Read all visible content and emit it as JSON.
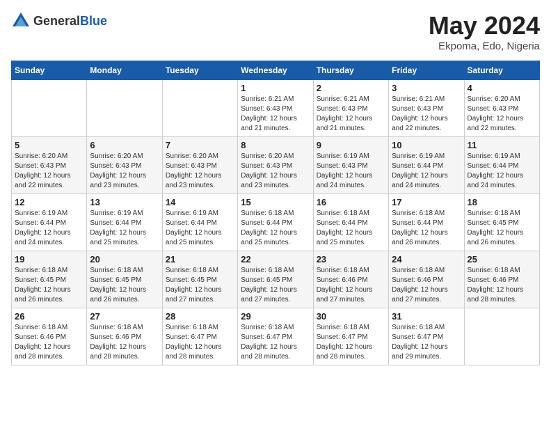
{
  "header": {
    "logo_general": "General",
    "logo_blue": "Blue",
    "title": "May 2024",
    "location": "Ekpoma, Edo, Nigeria"
  },
  "days_of_week": [
    "Sunday",
    "Monday",
    "Tuesday",
    "Wednesday",
    "Thursday",
    "Friday",
    "Saturday"
  ],
  "weeks": [
    [
      {
        "day": "",
        "sunrise": "",
        "sunset": "",
        "daylight": ""
      },
      {
        "day": "",
        "sunrise": "",
        "sunset": "",
        "daylight": ""
      },
      {
        "day": "",
        "sunrise": "",
        "sunset": "",
        "daylight": ""
      },
      {
        "day": "1",
        "sunrise": "Sunrise: 6:21 AM",
        "sunset": "Sunset: 6:43 PM",
        "daylight": "Daylight: 12 hours and 21 minutes."
      },
      {
        "day": "2",
        "sunrise": "Sunrise: 6:21 AM",
        "sunset": "Sunset: 6:43 PM",
        "daylight": "Daylight: 12 hours and 21 minutes."
      },
      {
        "day": "3",
        "sunrise": "Sunrise: 6:21 AM",
        "sunset": "Sunset: 6:43 PM",
        "daylight": "Daylight: 12 hours and 22 minutes."
      },
      {
        "day": "4",
        "sunrise": "Sunrise: 6:20 AM",
        "sunset": "Sunset: 6:43 PM",
        "daylight": "Daylight: 12 hours and 22 minutes."
      }
    ],
    [
      {
        "day": "5",
        "sunrise": "Sunrise: 6:20 AM",
        "sunset": "Sunset: 6:43 PM",
        "daylight": "Daylight: 12 hours and 22 minutes."
      },
      {
        "day": "6",
        "sunrise": "Sunrise: 6:20 AM",
        "sunset": "Sunset: 6:43 PM",
        "daylight": "Daylight: 12 hours and 23 minutes."
      },
      {
        "day": "7",
        "sunrise": "Sunrise: 6:20 AM",
        "sunset": "Sunset: 6:43 PM",
        "daylight": "Daylight: 12 hours and 23 minutes."
      },
      {
        "day": "8",
        "sunrise": "Sunrise: 6:20 AM",
        "sunset": "Sunset: 6:43 PM",
        "daylight": "Daylight: 12 hours and 23 minutes."
      },
      {
        "day": "9",
        "sunrise": "Sunrise: 6:19 AM",
        "sunset": "Sunset: 6:43 PM",
        "daylight": "Daylight: 12 hours and 24 minutes."
      },
      {
        "day": "10",
        "sunrise": "Sunrise: 6:19 AM",
        "sunset": "Sunset: 6:44 PM",
        "daylight": "Daylight: 12 hours and 24 minutes."
      },
      {
        "day": "11",
        "sunrise": "Sunrise: 6:19 AM",
        "sunset": "Sunset: 6:44 PM",
        "daylight": "Daylight: 12 hours and 24 minutes."
      }
    ],
    [
      {
        "day": "12",
        "sunrise": "Sunrise: 6:19 AM",
        "sunset": "Sunset: 6:44 PM",
        "daylight": "Daylight: 12 hours and 24 minutes."
      },
      {
        "day": "13",
        "sunrise": "Sunrise: 6:19 AM",
        "sunset": "Sunset: 6:44 PM",
        "daylight": "Daylight: 12 hours and 25 minutes."
      },
      {
        "day": "14",
        "sunrise": "Sunrise: 6:19 AM",
        "sunset": "Sunset: 6:44 PM",
        "daylight": "Daylight: 12 hours and 25 minutes."
      },
      {
        "day": "15",
        "sunrise": "Sunrise: 6:18 AM",
        "sunset": "Sunset: 6:44 PM",
        "daylight": "Daylight: 12 hours and 25 minutes."
      },
      {
        "day": "16",
        "sunrise": "Sunrise: 6:18 AM",
        "sunset": "Sunset: 6:44 PM",
        "daylight": "Daylight: 12 hours and 25 minutes."
      },
      {
        "day": "17",
        "sunrise": "Sunrise: 6:18 AM",
        "sunset": "Sunset: 6:44 PM",
        "daylight": "Daylight: 12 hours and 26 minutes."
      },
      {
        "day": "18",
        "sunrise": "Sunrise: 6:18 AM",
        "sunset": "Sunset: 6:45 PM",
        "daylight": "Daylight: 12 hours and 26 minutes."
      }
    ],
    [
      {
        "day": "19",
        "sunrise": "Sunrise: 6:18 AM",
        "sunset": "Sunset: 6:45 PM",
        "daylight": "Daylight: 12 hours and 26 minutes."
      },
      {
        "day": "20",
        "sunrise": "Sunrise: 6:18 AM",
        "sunset": "Sunset: 6:45 PM",
        "daylight": "Daylight: 12 hours and 26 minutes."
      },
      {
        "day": "21",
        "sunrise": "Sunrise: 6:18 AM",
        "sunset": "Sunset: 6:45 PM",
        "daylight": "Daylight: 12 hours and 27 minutes."
      },
      {
        "day": "22",
        "sunrise": "Sunrise: 6:18 AM",
        "sunset": "Sunset: 6:45 PM",
        "daylight": "Daylight: 12 hours and 27 minutes."
      },
      {
        "day": "23",
        "sunrise": "Sunrise: 6:18 AM",
        "sunset": "Sunset: 6:46 PM",
        "daylight": "Daylight: 12 hours and 27 minutes."
      },
      {
        "day": "24",
        "sunrise": "Sunrise: 6:18 AM",
        "sunset": "Sunset: 6:46 PM",
        "daylight": "Daylight: 12 hours and 27 minutes."
      },
      {
        "day": "25",
        "sunrise": "Sunrise: 6:18 AM",
        "sunset": "Sunset: 6:46 PM",
        "daylight": "Daylight: 12 hours and 28 minutes."
      }
    ],
    [
      {
        "day": "26",
        "sunrise": "Sunrise: 6:18 AM",
        "sunset": "Sunset: 6:46 PM",
        "daylight": "Daylight: 12 hours and 28 minutes."
      },
      {
        "day": "27",
        "sunrise": "Sunrise: 6:18 AM",
        "sunset": "Sunset: 6:46 PM",
        "daylight": "Daylight: 12 hours and 28 minutes."
      },
      {
        "day": "28",
        "sunrise": "Sunrise: 6:18 AM",
        "sunset": "Sunset: 6:47 PM",
        "daylight": "Daylight: 12 hours and 28 minutes."
      },
      {
        "day": "29",
        "sunrise": "Sunrise: 6:18 AM",
        "sunset": "Sunset: 6:47 PM",
        "daylight": "Daylight: 12 hours and 28 minutes."
      },
      {
        "day": "30",
        "sunrise": "Sunrise: 6:18 AM",
        "sunset": "Sunset: 6:47 PM",
        "daylight": "Daylight: 12 hours and 28 minutes."
      },
      {
        "day": "31",
        "sunrise": "Sunrise: 6:18 AM",
        "sunset": "Sunset: 6:47 PM",
        "daylight": "Daylight: 12 hours and 29 minutes."
      },
      {
        "day": "",
        "sunrise": "",
        "sunset": "",
        "daylight": ""
      }
    ]
  ]
}
